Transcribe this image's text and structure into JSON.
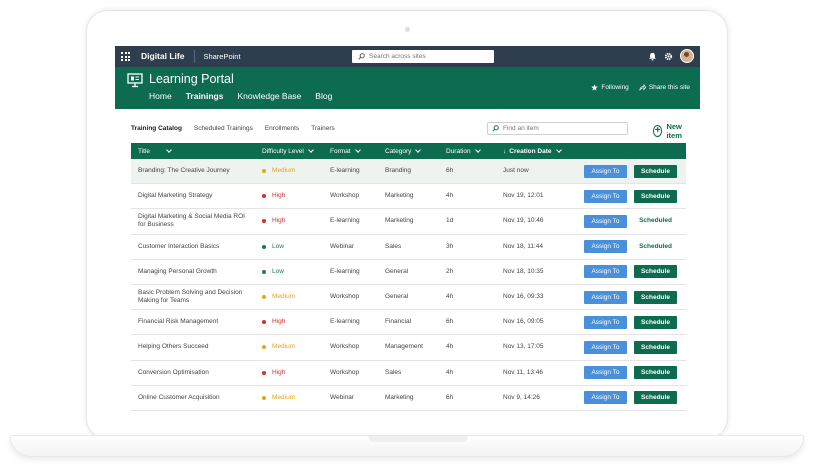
{
  "suite": {
    "app_name": "Digital Life",
    "product": "SharePoint",
    "search_placeholder": "Search across sites"
  },
  "site": {
    "title": "Learning Portal",
    "nav": [
      "Home",
      "Trainings",
      "Knowledge Base",
      "Blog"
    ],
    "active_nav": "Trainings",
    "following_label": "Following",
    "share_label": "Share this site"
  },
  "tabs": [
    "Training Catalog",
    "Scheduled Trainings",
    "Enrollments",
    "Trainers"
  ],
  "find_placeholder": "Find an item",
  "new_item_label": "New item",
  "columns": {
    "title": "Title",
    "difficulty": "Difficulty Level",
    "format": "Format",
    "category": "Category",
    "duration": "Duration",
    "creation_date": "Creation Date"
  },
  "colors": {
    "brand": "#0d6b4f",
    "suite_bar": "#2f3e4e",
    "assign": "#4a8fd9",
    "medium": "#e8a317",
    "high": "#d0302f",
    "low": "#1f7a4d"
  },
  "rows": [
    {
      "title": "Branding: The Creative Journey",
      "difficulty": "Medium",
      "format": "E-learning",
      "category": "Branding",
      "duration": "6h",
      "date": "Just now",
      "assign": "Assign To",
      "schedule": "Schedule",
      "scheduled": false
    },
    {
      "title": "Digital Marketing Strategy",
      "difficulty": "High",
      "format": "Workshop",
      "category": "Marketing",
      "duration": "4h",
      "date": "Nov 19, 12:01",
      "assign": "Assign To",
      "schedule": "Schedule",
      "scheduled": false
    },
    {
      "title": "Digital Marketing & Social Media ROI for Business",
      "difficulty": "High",
      "format": "E-learning",
      "category": "Marketing",
      "duration": "1d",
      "date": "Nov 19, 10:46",
      "assign": "Assign To",
      "schedule": "Scheduled",
      "scheduled": true
    },
    {
      "title": "Customer Interaction Basics",
      "difficulty": "Low",
      "format": "Webinar",
      "category": "Sales",
      "duration": "3h",
      "date": "Nov 18, 11:44",
      "assign": "Assign To",
      "schedule": "Scheduled",
      "scheduled": true
    },
    {
      "title": "Managing Personal Growth",
      "difficulty": "Low",
      "format": "E-learning",
      "category": "General",
      "duration": "2h",
      "date": "Nov 18, 10:35",
      "assign": "Assign To",
      "schedule": "Schedule",
      "scheduled": false
    },
    {
      "title": "Basic Problem Solving and Decision Making for Teams",
      "difficulty": "Medium",
      "format": "Workshop",
      "category": "General",
      "duration": "4h",
      "date": "Nov 16, 09:33",
      "assign": "Assign To",
      "schedule": "Schedule",
      "scheduled": false
    },
    {
      "title": "Financial Risk Management",
      "difficulty": "High",
      "format": "E-learning",
      "category": "Financial",
      "duration": "6h",
      "date": "Nov 16, 09:05",
      "assign": "Assign To",
      "schedule": "Schedule",
      "scheduled": false
    },
    {
      "title": "Helping Others Succeed",
      "difficulty": "Medium",
      "format": "Workshop",
      "category": "Management",
      "duration": "4h",
      "date": "Nov 13, 17:05",
      "assign": "Assign To",
      "schedule": "Schedule",
      "scheduled": false
    },
    {
      "title": "Conversion Optimisation",
      "difficulty": "High",
      "format": "Workshop",
      "category": "Sales",
      "duration": "4h",
      "date": "Nov 11, 13:46",
      "assign": "Assign To",
      "schedule": "Schedule",
      "scheduled": false
    },
    {
      "title": "Online Customer Acquisition",
      "difficulty": "Medium",
      "format": "Webinar",
      "category": "Marketing",
      "duration": "6h",
      "date": "Nov 9, 14:26",
      "assign": "Assign To",
      "schedule": "Schedule",
      "scheduled": false
    }
  ]
}
